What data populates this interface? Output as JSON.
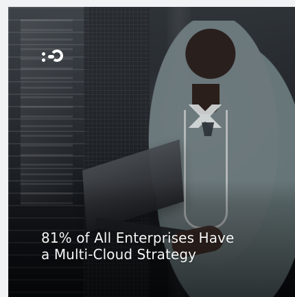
{
  "brand": {
    "logo_icon": "brand-mark-icon"
  },
  "hero": {
    "headline_line_1": "81% of All Enterprises Have",
    "headline_line_2": "a Multi-Cloud Strategy"
  }
}
